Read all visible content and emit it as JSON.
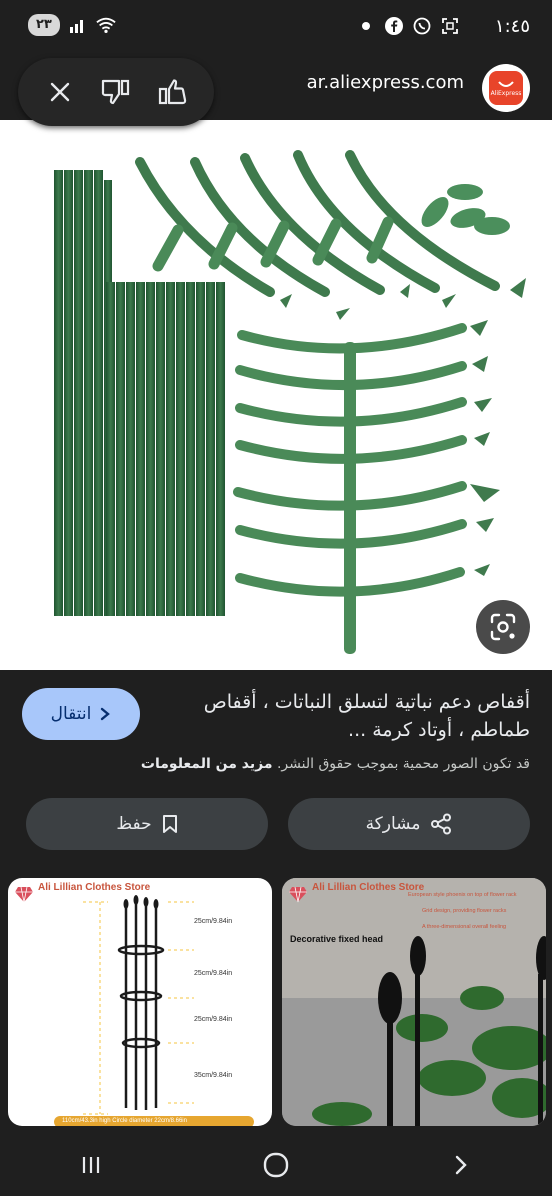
{
  "status": {
    "time": "١:٤٥",
    "battery": "٢٣"
  },
  "top_bar": {
    "site_url": "ar.aliexpress.com",
    "logo_text": "AliExpress"
  },
  "result": {
    "title": "أقفاص دعم نباتية لتسلق النباتات ، أقفاص طماطم ، أوتاد كرمة ...",
    "visit_label": "انتقال",
    "copyright_text": "قد تكون الصور محمية بموجب حقوق النشر.",
    "more_info_label": "مزيد من المعلومات"
  },
  "actions": {
    "share_label": "مشاركة",
    "save_label": "حفظ"
  },
  "related": [
    {
      "store": "Ali Lillian Clothes Store",
      "labels": [
        "25cm/9.84in",
        "25cm/9.84in",
        "25cm/9.84in",
        "35cm/9.84in"
      ],
      "footer": "110cm/43.3in high    Circle diameter 22cm/8.66in"
    },
    {
      "store": "Ali Lillian Clothes Store",
      "caption": "Decorative fixed head",
      "notes": [
        "European style phoenix on top of flower rack",
        "Grid design, providing flower racks",
        "A three-dimensional overall feeling"
      ]
    }
  ],
  "colors": {
    "accent": "#a8c7fa",
    "background": "#1f1f1f",
    "pill": "#3c4043",
    "plant_green": "#3f7a4d",
    "stake_green": "#2f6a3e"
  }
}
